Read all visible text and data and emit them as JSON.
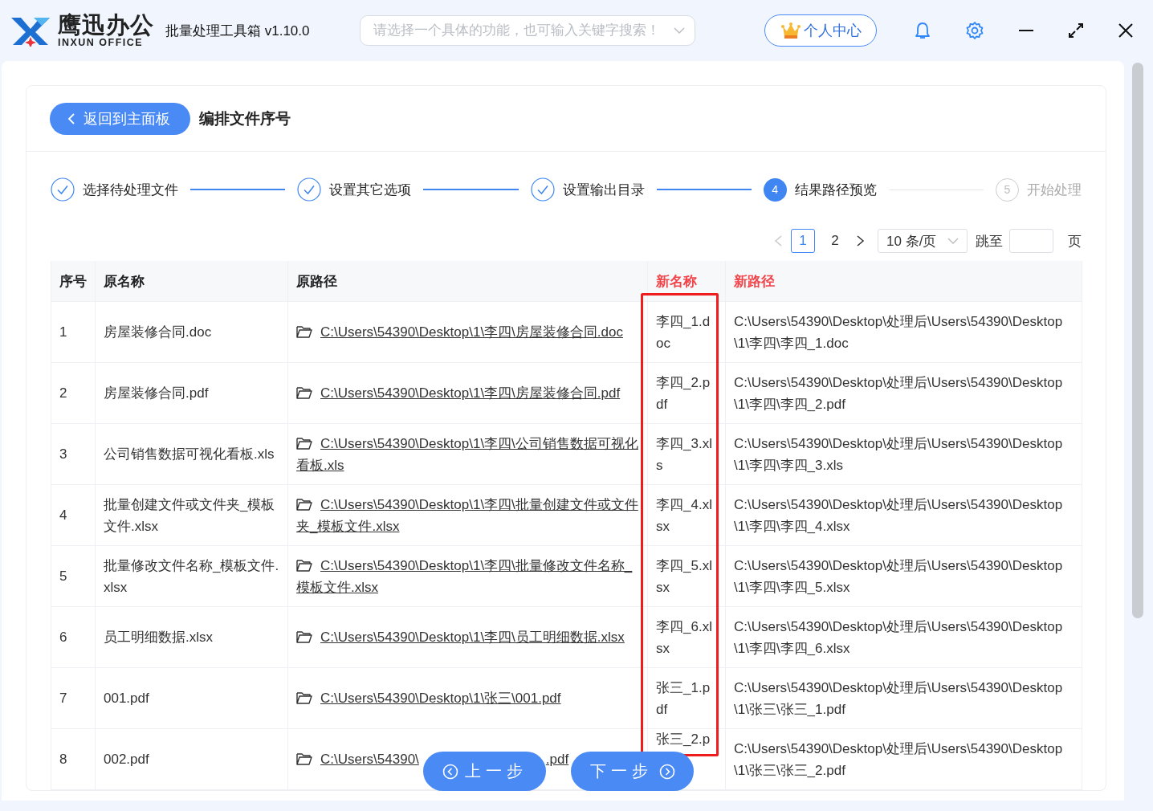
{
  "app": {
    "brand": "鹰迅办公",
    "brand_sub": "INXUN OFFICE",
    "title": "批量处理工具箱 v1.10.0",
    "search": {
      "placeholder": "请选择一个具体的功能，也可输入关键字搜索！"
    },
    "account_button": "个人中心"
  },
  "page": {
    "back_button": "返回到主面板",
    "title": "编排文件序号"
  },
  "steps": [
    {
      "label": "选择待处理文件",
      "completed": true
    },
    {
      "label": "设置其它选项",
      "completed": true
    },
    {
      "label": "设置输出目录",
      "completed": true
    },
    {
      "label": "结果路径预览",
      "completed": false,
      "current": true,
      "number": "4"
    },
    {
      "label": "开始处理",
      "completed": false,
      "current": false,
      "number": "5"
    }
  ],
  "pagination": {
    "pages": [
      {
        "label": "1",
        "selected": true
      },
      {
        "label": "2",
        "selected": false
      }
    ],
    "prev_disabled": true,
    "page_size": "10 条/页",
    "jump_label": "跳至",
    "jump_suffix": "页"
  },
  "table": {
    "columns": [
      {
        "label": "序号",
        "kind": "text",
        "emphasis": false,
        "framed": false
      },
      {
        "label": "原名称",
        "kind": "text",
        "emphasis": false,
        "framed": false
      },
      {
        "label": "原路径",
        "kind": "path",
        "emphasis": false,
        "framed": false
      },
      {
        "label": "新名称",
        "kind": "text",
        "emphasis": true,
        "framed": true
      },
      {
        "label": "新路径",
        "kind": "text",
        "emphasis": true,
        "framed": false
      }
    ],
    "rows": [
      [
        "1",
        "房屋装修合同.doc",
        "C:\\Users\\54390\\Desktop\\1\\李四\\房屋装修合同.doc",
        "李四_1.doc",
        "C:\\Users\\54390\\Desktop\\处理后\\Users\\54390\\Desktop\\1\\李四\\李四_1.doc"
      ],
      [
        "2",
        "房屋装修合同.pdf",
        "C:\\Users\\54390\\Desktop\\1\\李四\\房屋装修合同.pdf",
        "李四_2.pdf",
        "C:\\Users\\54390\\Desktop\\处理后\\Users\\54390\\Desktop\\1\\李四\\李四_2.pdf"
      ],
      [
        "3",
        "公司销售数据可视化看板.xls",
        "C:\\Users\\54390\\Desktop\\1\\李四\\公司销售数据可视化看板.xls",
        "李四_3.xls",
        "C:\\Users\\54390\\Desktop\\处理后\\Users\\54390\\Desktop\\1\\李四\\李四_3.xls"
      ],
      [
        "4",
        "批量创建文件或文件夹_模板文件.xlsx",
        "C:\\Users\\54390\\Desktop\\1\\李四\\批量创建文件或文件夹_模板文件.xlsx",
        "李四_4.xlsx",
        "C:\\Users\\54390\\Desktop\\处理后\\Users\\54390\\Desktop\\1\\李四\\李四_4.xlsx"
      ],
      [
        "5",
        "批量修改文件名称_模板文件.xlsx",
        "C:\\Users\\54390\\Desktop\\1\\李四\\批量修改文件名称_模板文件.xlsx",
        "李四_5.xlsx",
        "C:\\Users\\54390\\Desktop\\处理后\\Users\\54390\\Desktop\\1\\李四\\李四_5.xlsx"
      ],
      [
        "6",
        "员工明细数据.xlsx",
        "C:\\Users\\54390\\Desktop\\1\\李四\\员工明细数据.xlsx",
        "李四_6.xlsx",
        "C:\\Users\\54390\\Desktop\\处理后\\Users\\54390\\Desktop\\1\\李四\\李四_6.xlsx"
      ],
      [
        "7",
        "001.pdf",
        "C:\\Users\\54390\\Desktop\\1\\张三\\001.pdf",
        "张三_1.pdf",
        "C:\\Users\\54390\\Desktop\\处理后\\Users\\54390\\Desktop\\1\\张三\\张三_1.pdf"
      ],
      [
        "8",
        "002.pdf",
        {
          "kind": "covered",
          "before": "C:\\Users\\54390\\",
          "after": ".pdf"
        },
        {
          "kind": "cut",
          "text": "张三_2.p"
        },
        "C:\\Users\\54390\\Desktop\\处理后\\Users\\54390\\Desktop\\1\\张三\\张三_2.pdf"
      ]
    ]
  },
  "nav": {
    "prev": "上一步",
    "next": "下一步"
  }
}
